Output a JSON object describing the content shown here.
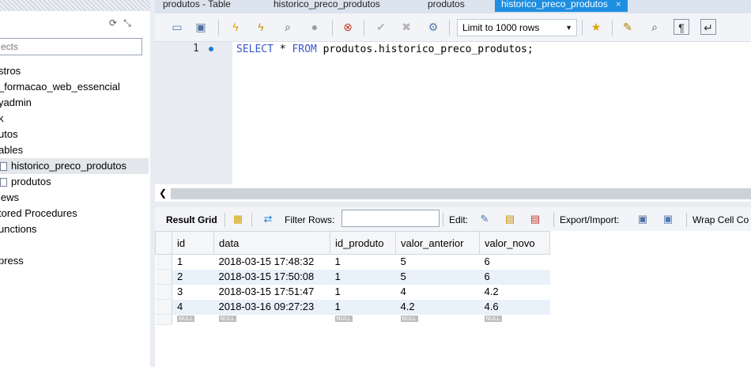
{
  "tabs": [
    {
      "label": "produtos - Table"
    },
    {
      "label": "historico_preco_produtos"
    },
    {
      "label": "produtos"
    },
    {
      "label": "historico_preco_produtos",
      "active": true
    }
  ],
  "tab_close": "×",
  "sidebar": {
    "search_placeholder": "ects",
    "items": [
      {
        "label": "stros"
      },
      {
        "label": "_formacao_web_essencial"
      },
      {
        "label": "yadmin"
      },
      {
        "label": "k"
      },
      {
        "label": "utos"
      },
      {
        "label": "ables"
      },
      {
        "label": "historico_preco_produtos",
        "selected": true
      },
      {
        "label": "produtos"
      },
      {
        "label": "iews"
      },
      {
        "label": "tored Procedures"
      },
      {
        "label": "unctions"
      },
      {
        "label": ""
      },
      {
        "label": "press"
      }
    ]
  },
  "toolbar": {
    "limit_label": "Limit to 1000 rows"
  },
  "editor": {
    "line_number": "1",
    "keyword_select": "SELECT",
    "star": " * ",
    "keyword_from": "FROM",
    "rest": " produtos.historico_preco_produtos;"
  },
  "result_toolbar": {
    "result_grid": "Result Grid",
    "filter_rows": "Filter Rows:",
    "filter_value": "",
    "edit": "Edit:",
    "export_import": "Export/Import:",
    "wrap_cell": "Wrap Cell Co"
  },
  "grid": {
    "columns": [
      "id",
      "data",
      "id_produto",
      "valor_anterior",
      "valor_novo"
    ],
    "rows": [
      [
        "1",
        "2018-03-15 17:48:32",
        "1",
        "5",
        "6"
      ],
      [
        "2",
        "2018-03-15 17:50:08",
        "1",
        "5",
        "6"
      ],
      [
        "3",
        "2018-03-15 17:51:47",
        "1",
        "4",
        "4.2"
      ],
      [
        "4",
        "2018-03-16 09:27:23",
        "1",
        "4.2",
        "4.6"
      ]
    ],
    "null_label": "NULL"
  },
  "colors": {
    "active_tab": "#1e8ee0",
    "keyword": "#3a57c9",
    "row_alt": "#e9f1fb"
  }
}
